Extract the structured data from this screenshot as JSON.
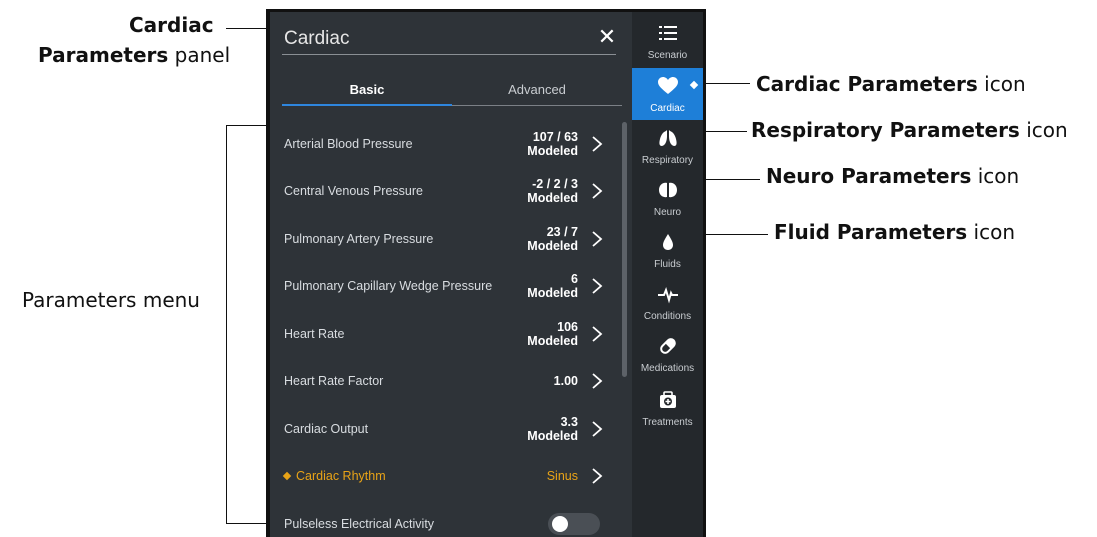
{
  "callouts": {
    "panel_bold_1": "Cardiac",
    "panel_bold_2": "Parameters",
    "panel_normal": " panel",
    "menu": "Parameters menu",
    "cardiac_bold": "Cardiac Parameters",
    "respiratory_bold": "Respiratory Parameters",
    "neuro_bold": "Neuro Parameters",
    "fluid_bold": "Fluid Parameters",
    "icon_suffix": " icon"
  },
  "panel": {
    "title": "Cardiac",
    "close_glyph": "✕",
    "tabs": [
      {
        "label": "Basic"
      },
      {
        "label": "Advanced"
      }
    ],
    "params": [
      {
        "label": "Arterial Blood Pressure",
        "value_line1": "107 / 63",
        "value_line2": "Modeled"
      },
      {
        "label": "Central Venous Pressure",
        "value_line1": "-2 / 2 / 3",
        "value_line2": "Modeled"
      },
      {
        "label": "Pulmonary Artery Pressure",
        "value_line1": "23 / 7",
        "value_line2": "Modeled"
      },
      {
        "label": "Pulmonary Capillary Wedge Pressure",
        "value_line1": "6",
        "value_line2": "Modeled"
      },
      {
        "label": "Heart Rate",
        "value_line1": "106",
        "value_line2": "Modeled"
      },
      {
        "label": "Heart Rate Factor",
        "value_line1": "1.00",
        "value_line2": ""
      },
      {
        "label": "Cardiac Output",
        "value_line1": "3.3",
        "value_line2": "Modeled"
      },
      {
        "label": "Cardiac Rhythm",
        "value_line1": "Sinus",
        "value_line2": ""
      },
      {
        "label": "Pulseless Electrical Activity",
        "toggle": false
      }
    ]
  },
  "sidenav": {
    "items": [
      {
        "label": "Scenario",
        "icon": "list-icon"
      },
      {
        "label": "Cardiac",
        "icon": "heart-icon"
      },
      {
        "label": "Respiratory",
        "icon": "lungs-icon"
      },
      {
        "label": "Neuro",
        "icon": "brain-icon"
      },
      {
        "label": "Fluids",
        "icon": "droplet-icon"
      },
      {
        "label": "Conditions",
        "icon": "pulse-icon"
      },
      {
        "label": "Medications",
        "icon": "pill-icon"
      },
      {
        "label": "Treatments",
        "icon": "medkit-icon"
      }
    ]
  },
  "colors": {
    "panel_bg": "#2e3338",
    "nav_bg": "#24282c",
    "accent": "#1e7fd8",
    "highlight": "#e8a317"
  }
}
